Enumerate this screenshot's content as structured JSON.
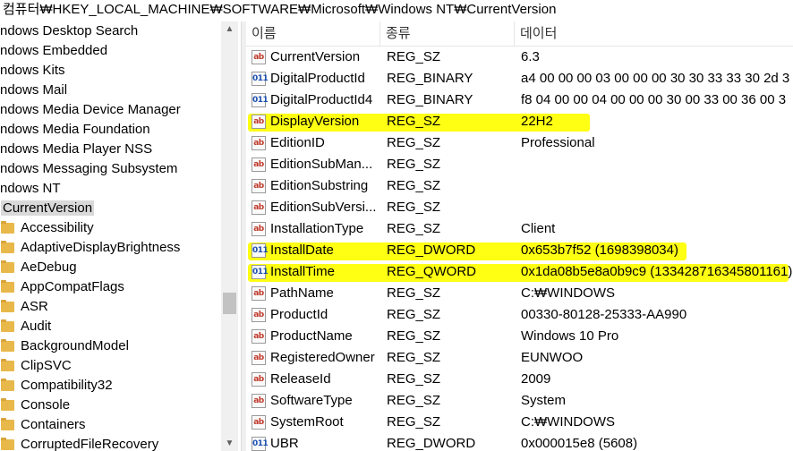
{
  "address_path": "컴퓨터₩HKEY_LOCAL_MACHINE₩SOFTWARE₩Microsoft₩Windows NT₩CurrentVersion",
  "tree": {
    "cut_items": [
      "ndows Desktop Search",
      "ndows Embedded",
      "ndows Kits",
      "ndows Mail",
      "ndows Media Device Manager",
      "ndows Media Foundation",
      "ndows Media Player NSS",
      "ndows Messaging Subsystem",
      "ndows NT"
    ],
    "selected": "CurrentVersion",
    "children": [
      "Accessibility",
      "AdaptiveDisplayBrightness",
      "AeDebug",
      "AppCompatFlags",
      "ASR",
      "Audit",
      "BackgroundModel",
      "ClipSVC",
      "Compatibility32",
      "Console",
      "Containers",
      "CorruptedFileRecovery"
    ]
  },
  "list": {
    "headers": {
      "name": "이름",
      "type": "종류",
      "data": "데이터"
    },
    "rows": [
      {
        "name": "CurrentVersion",
        "type": "REG_SZ",
        "data": "6.3",
        "icon": "string"
      },
      {
        "name": "DigitalProductId",
        "type": "REG_BINARY",
        "data": "a4 00 00 00 03 00 00 00 30 30 33 33 30 2d 3",
        "icon": "binary"
      },
      {
        "name": "DigitalProductId4",
        "type": "REG_BINARY",
        "data": "f8 04 00 00 04 00 00 00 30 00 33 00 36 00 3",
        "icon": "binary"
      },
      {
        "name": "DisplayVersion",
        "type": "REG_SZ",
        "data": "22H2",
        "icon": "string",
        "highlight": true
      },
      {
        "name": "EditionID",
        "type": "REG_SZ",
        "data": "Professional",
        "icon": "string"
      },
      {
        "name": "EditionSubMan...",
        "type": "REG_SZ",
        "data": "",
        "icon": "string"
      },
      {
        "name": "EditionSubstring",
        "type": "REG_SZ",
        "data": "",
        "icon": "string"
      },
      {
        "name": "EditionSubVersi...",
        "type": "REG_SZ",
        "data": "",
        "icon": "string"
      },
      {
        "name": "InstallationType",
        "type": "REG_SZ",
        "data": "Client",
        "icon": "string"
      },
      {
        "name": "InstallDate",
        "type": "REG_DWORD",
        "data": "0x653b7f52 (1698398034)",
        "icon": "binary",
        "highlight": true
      },
      {
        "name": "InstallTime",
        "type": "REG_QWORD",
        "data": "0x1da08b5e8a0b9c9 (133428716345801161)",
        "icon": "binary",
        "highlight": true
      },
      {
        "name": "PathName",
        "type": "REG_SZ",
        "data": "C:₩WINDOWS",
        "icon": "string"
      },
      {
        "name": "ProductId",
        "type": "REG_SZ",
        "data": "00330-80128-25333-AA990",
        "icon": "string"
      },
      {
        "name": "ProductName",
        "type": "REG_SZ",
        "data": "Windows 10 Pro",
        "icon": "string"
      },
      {
        "name": "RegisteredOwner",
        "type": "REG_SZ",
        "data": "EUNWOO",
        "icon": "string"
      },
      {
        "name": "ReleaseId",
        "type": "REG_SZ",
        "data": "2009",
        "icon": "string"
      },
      {
        "name": "SoftwareType",
        "type": "REG_SZ",
        "data": "System",
        "icon": "string"
      },
      {
        "name": "SystemRoot",
        "type": "REG_SZ",
        "data": "C:₩WINDOWS",
        "icon": "string"
      },
      {
        "name": "UBR",
        "type": "REG_DWORD",
        "data": "0x000015e8 (5608)",
        "icon": "binary"
      }
    ]
  },
  "icon_glyphs": {
    "string": "ab",
    "binary": "011"
  },
  "colors": {
    "highlight": "#ffff14",
    "selected_tree": "#d9d9d9"
  }
}
